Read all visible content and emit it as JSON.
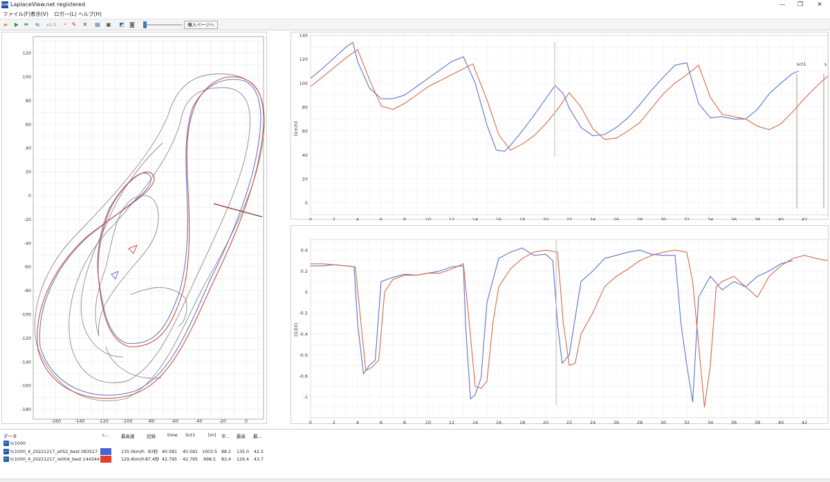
{
  "window": {
    "title": "LaplaceView.net registered",
    "icon_text": "Lvw",
    "minimize": "—",
    "maximize": "❐",
    "close": "✕"
  },
  "menu": [
    "ファイル(F)",
    "表示(V)",
    "ロガー(L)",
    "ヘルプ(H)"
  ],
  "toolbar": {
    "speed": "x1.0",
    "buy_label": "購入ページへ",
    "playback_position": 0.02
  },
  "map_chart": {
    "x_ticks": [
      "-160",
      "-140",
      "-120",
      "-100",
      "-80",
      "-60",
      "-40",
      "-20",
      "0"
    ],
    "y_ticks": [
      "120",
      "100",
      "80",
      "60",
      "40",
      "20",
      "0",
      "-20",
      "-40",
      "-60",
      "-80",
      "-100",
      "-120",
      "-140",
      "-160",
      "-180"
    ]
  },
  "chart_data": [
    {
      "type": "line",
      "ylabel": "[km/h]",
      "xlim": [
        0,
        44
      ],
      "ylim": [
        -10,
        140
      ],
      "x_ticks": [
        "0",
        "2",
        "4",
        "6",
        "8",
        "10",
        "12",
        "14",
        "16",
        "18",
        "20",
        "22",
        "24",
        "26",
        "28",
        "30",
        "32",
        "34",
        "36",
        "38",
        "40",
        "42"
      ],
      "y_ticks": [
        "140",
        "120",
        "100",
        "80",
        "60",
        "40",
        "20",
        "0"
      ],
      "annotations": [
        "sct1",
        "s"
      ],
      "series": [
        {
          "color": "#5a74c8",
          "x": [
            0,
            1,
            2,
            3,
            3.6,
            4,
            5,
            6,
            7,
            8,
            9,
            10,
            11,
            12,
            13,
            14,
            15,
            15.8,
            16.5,
            17,
            18,
            19,
            20,
            20.8,
            21.5,
            22,
            23,
            24,
            25,
            26,
            27,
            28,
            29,
            30,
            31,
            32,
            33,
            34,
            35,
            36,
            37,
            38,
            39,
            40,
            41,
            41.5
          ],
          "y": [
            104,
            112,
            121,
            130,
            134,
            118,
            96,
            87,
            87,
            90,
            97,
            104,
            111,
            118,
            122,
            100,
            65,
            44,
            43,
            48,
            60,
            73,
            87,
            98,
            91,
            79,
            63,
            56,
            57,
            63,
            71,
            82,
            94,
            105,
            115,
            117,
            83,
            71,
            72,
            70,
            70,
            78,
            91,
            100,
            108,
            110
          ]
        },
        {
          "color": "#d36a4a",
          "x": [
            0,
            1,
            2,
            3,
            4,
            5,
            6,
            7,
            8,
            9,
            10,
            11,
            12,
            13,
            13.8,
            15,
            16,
            17,
            18,
            19,
            20,
            21,
            22,
            23,
            24,
            25,
            26,
            27,
            28,
            29,
            30,
            31,
            32,
            33,
            34,
            35,
            36,
            37,
            38,
            39,
            40,
            41,
            42,
            43,
            44
          ],
          "y": [
            97,
            105,
            113,
            121,
            128,
            103,
            81,
            78,
            83,
            90,
            97,
            102,
            107,
            112,
            116,
            86,
            57,
            44,
            49,
            56,
            66,
            78,
            92,
            80,
            62,
            53,
            54,
            60,
            67,
            79,
            91,
            100,
            107,
            115,
            88,
            74,
            72,
            70,
            64,
            61,
            66,
            76,
            87,
            97,
            106
          ]
        }
      ]
    },
    {
      "type": "line",
      "ylabel": "[G](X)",
      "xlim": [
        0,
        44
      ],
      "ylim": [
        -1.2,
        0.5
      ],
      "x_ticks": [
        "0",
        "2",
        "4",
        "6",
        "8",
        "10",
        "12",
        "14",
        "16",
        "18",
        "20",
        "22",
        "24",
        "26",
        "28",
        "30",
        "32",
        "34",
        "36",
        "38",
        "40",
        "42"
      ],
      "y_ticks": [
        "0.4",
        "0.2",
        "0",
        "-0.2",
        "-0.4",
        "-0.6",
        "-0.8",
        "-1"
      ],
      "series": [
        {
          "color": "#5a74c8",
          "x": [
            0,
            1,
            2,
            3,
            3.7,
            4,
            4.5,
            5,
            5.5,
            6,
            7,
            8,
            9,
            10,
            11,
            12,
            13,
            13.2,
            13.6,
            14,
            14.5,
            15,
            16,
            17,
            18,
            19,
            20,
            20.6,
            21,
            21.4,
            22,
            23,
            24,
            25,
            26,
            27,
            28,
            29,
            30,
            31,
            31.5,
            32,
            32.5,
            33,
            34,
            35,
            36,
            37,
            38,
            39,
            40,
            41
          ],
          "y": [
            0.25,
            0.25,
            0.26,
            0.25,
            0.24,
            -0.3,
            -0.78,
            -0.7,
            -0.65,
            0.1,
            0.14,
            0.17,
            0.16,
            0.18,
            0.2,
            0.24,
            0.25,
            -0.35,
            -1.02,
            -0.98,
            -0.82,
            -0.1,
            0.32,
            0.38,
            0.42,
            0.35,
            0.36,
            0.3,
            -0.3,
            -0.68,
            -0.6,
            0.1,
            0.2,
            0.32,
            0.35,
            0.38,
            0.4,
            0.36,
            0.35,
            0.35,
            -0.3,
            -0.7,
            -1.05,
            -0.05,
            0.15,
            0.02,
            0.1,
            0.05,
            0.15,
            0.2,
            0.27,
            0.3
          ]
        },
        {
          "color": "#d36a4a",
          "x": [
            0,
            1,
            2,
            3,
            3.8,
            4.2,
            4.7,
            5.2,
            5.8,
            6.3,
            7,
            8,
            9,
            10,
            11,
            12,
            13,
            13.5,
            14,
            14.5,
            15,
            15.5,
            16,
            17,
            18,
            19,
            20,
            21,
            21.5,
            22,
            22.5,
            23,
            24,
            25,
            26,
            27,
            28,
            29,
            30,
            31,
            32,
            32.5,
            33,
            33.5,
            34,
            34.5,
            35,
            36,
            37,
            38,
            39,
            40,
            41,
            42,
            43,
            44
          ],
          "y": [
            0.27,
            0.27,
            0.26,
            0.25,
            0.24,
            -0.2,
            -0.75,
            -0.72,
            -0.65,
            0,
            0.12,
            0.16,
            0.16,
            0.18,
            0.18,
            0.22,
            0.27,
            -0.3,
            -0.9,
            -0.92,
            -0.85,
            -0.3,
            0.05,
            0.22,
            0.32,
            0.38,
            0.4,
            0.38,
            -0.3,
            -0.7,
            -0.68,
            -0.4,
            -0.2,
            0.05,
            0.15,
            0.22,
            0.3,
            0.35,
            0.38,
            0.4,
            0.38,
            0.1,
            -0.5,
            -1.1,
            -0.7,
            0.05,
            0.1,
            0.15,
            0.05,
            -0.05,
            0.15,
            0.25,
            0.32,
            0.35,
            0.32,
            0.3
          ]
        }
      ]
    }
  ],
  "data_table": {
    "headers": [
      "データ",
      "c...",
      "最高速",
      "記録",
      "time",
      "Sct1",
      "[m]",
      "平...",
      "最高",
      "最..."
    ],
    "group": "tc1000",
    "rows": [
      {
        "name": "tc1000_4_20221217_a052_best 083527",
        "color": "#4a63d4",
        "max_speed": "135.0km/h",
        "record": "83秒",
        "time": "40.581",
        "sct1": "40.581",
        "distance": "1003.5",
        "avg": "88.2",
        "max": "135.0",
        "last": "42.5"
      },
      {
        "name": "tc1000_4_20221217_re004_best 144344",
        "color": "#e0402a",
        "max_speed": "129.4km/h",
        "record": "87.4秒",
        "time": "42.795",
        "sct1": "42.795",
        "distance": "998.5",
        "avg": "83.4",
        "max": "129.4",
        "last": "43.7"
      }
    ]
  }
}
